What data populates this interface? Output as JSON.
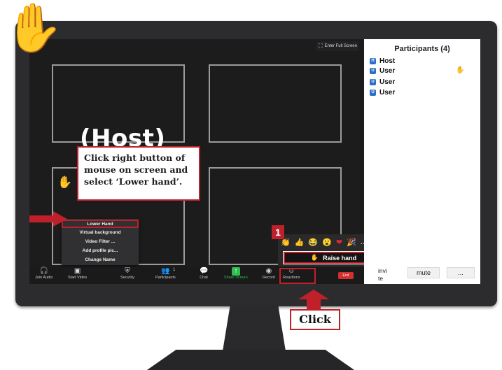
{
  "screen": {
    "fullscreen_label": "Enter Full Screen",
    "host_label": "(Host)",
    "tile_hand_icon": "raised-hand-icon"
  },
  "context_menu": {
    "items": [
      "Lower Hand",
      "Virtual background",
      "Video Filter ...",
      "Add profile pic...",
      "Change Name"
    ]
  },
  "toolbar": {
    "join_audio": "Join Audio",
    "start_video": "Start Video",
    "security": "Security",
    "participants": "Participants",
    "participants_count": "1",
    "chat": "Chat",
    "share_screen": "Share Screen",
    "record": "Record",
    "reactions": "Reactions",
    "end": "End"
  },
  "reactions": {
    "emojis": [
      "👏",
      "👍",
      "😂",
      "😮",
      "❤",
      "🎉",
      "..."
    ],
    "raise_hand_label": "Raise hand",
    "step_number": "1"
  },
  "participants_panel": {
    "title": "Participants (4)",
    "rows": [
      {
        "avatar": "H",
        "name": "Host"
      },
      {
        "avatar": "U",
        "name": "User"
      },
      {
        "avatar": "U",
        "name": "User"
      },
      {
        "avatar": "U",
        "name": "User"
      }
    ],
    "invite_label": "invi\nte",
    "mute_label": "mute",
    "more_label": "..."
  },
  "callout": {
    "text": "Click right button of mouse on screen and select  ‘Lower hand’."
  },
  "click_label": "Click",
  "colors": {
    "accent_red": "#c0202a",
    "hand_yellow": "#f6bd16",
    "screen_bg": "#1c1c1c",
    "share_green": "#2fbf4f",
    "avatar_blue": "#2d6fc4"
  }
}
